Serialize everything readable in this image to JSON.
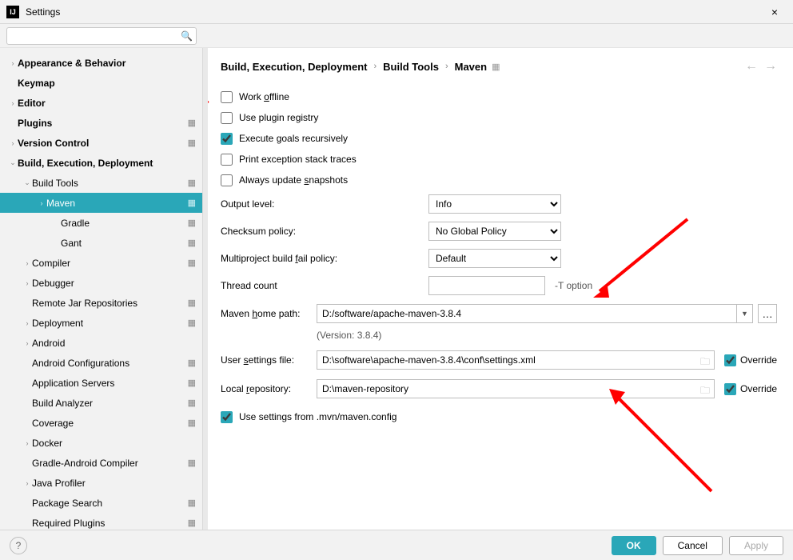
{
  "window": {
    "title": "Settings",
    "close": "×",
    "search_placeholder": ""
  },
  "sidebar": {
    "items": [
      {
        "label": "Appearance & Behavior",
        "arrow": "›",
        "bold": true,
        "indent": 0
      },
      {
        "label": "Keymap",
        "bold": true,
        "indent": 0
      },
      {
        "label": "Editor",
        "arrow": "›",
        "bold": true,
        "indent": 0
      },
      {
        "label": "Plugins",
        "bold": true,
        "indent": 0,
        "cfg": true
      },
      {
        "label": "Version Control",
        "arrow": "›",
        "bold": true,
        "indent": 0,
        "cfg": true
      },
      {
        "label": "Build, Execution, Deployment",
        "arrow": "⌄",
        "bold": true,
        "indent": 0
      },
      {
        "label": "Build Tools",
        "arrow": "⌄",
        "indent": 1,
        "cfg": true
      },
      {
        "label": "Maven",
        "arrow": "›",
        "indent": 2,
        "selected": true,
        "cfg": true
      },
      {
        "label": "Gradle",
        "indent": 3,
        "cfg": true
      },
      {
        "label": "Gant",
        "indent": 3,
        "cfg": true
      },
      {
        "label": "Compiler",
        "arrow": "›",
        "indent": 1,
        "cfg": true
      },
      {
        "label": "Debugger",
        "arrow": "›",
        "indent": 1
      },
      {
        "label": "Remote Jar Repositories",
        "indent": 1,
        "cfg": true
      },
      {
        "label": "Deployment",
        "arrow": "›",
        "indent": 1,
        "cfg": true
      },
      {
        "label": "Android",
        "arrow": "›",
        "indent": 1
      },
      {
        "label": "Android Configurations",
        "indent": 1,
        "cfg": true
      },
      {
        "label": "Application Servers",
        "indent": 1,
        "cfg": true
      },
      {
        "label": "Build Analyzer",
        "indent": 1,
        "cfg": true
      },
      {
        "label": "Coverage",
        "indent": 1,
        "cfg": true
      },
      {
        "label": "Docker",
        "arrow": "›",
        "indent": 1
      },
      {
        "label": "Gradle-Android Compiler",
        "indent": 1,
        "cfg": true
      },
      {
        "label": "Java Profiler",
        "arrow": "›",
        "indent": 1
      },
      {
        "label": "Package Search",
        "indent": 1,
        "cfg": true
      },
      {
        "label": "Required Plugins",
        "indent": 1,
        "cfg": true
      }
    ]
  },
  "breadcrumb": {
    "a": "Build, Execution, Deployment",
    "b": "Build Tools",
    "c": "Maven"
  },
  "checks": {
    "work_offline": "Work offline",
    "plugin_registry": "Use plugin registry",
    "execute_recursive": "Execute goals recursively",
    "print_traces": "Print exception stack traces",
    "update_snapshots": "Always update snapshots",
    "use_mvn_config": "Use settings from .mvn/maven.config"
  },
  "fields": {
    "output_level_label": "Output level:",
    "output_level_value": "Info",
    "checksum_label": "Checksum policy:",
    "checksum_value": "No Global Policy",
    "fail_policy_label": "Multiproject build fail policy:",
    "fail_policy_value": "Default",
    "thread_count_label": "Thread count",
    "thread_count_value": "",
    "thread_count_suffix": "-T option"
  },
  "paths": {
    "maven_home_label": "Maven home path:",
    "maven_home_value": "D:/software/apache-maven-3.8.4",
    "version_note": "(Version: 3.8.4)",
    "user_settings_label": "User settings file:",
    "user_settings_value": "D:\\software\\apache-maven-3.8.4\\conf\\settings.xml",
    "local_repo_label": "Local repository:",
    "local_repo_value": "D:\\maven-repository",
    "override_label": "Override"
  },
  "footer": {
    "ok": "OK",
    "cancel": "Cancel",
    "apply": "Apply",
    "help": "?"
  }
}
